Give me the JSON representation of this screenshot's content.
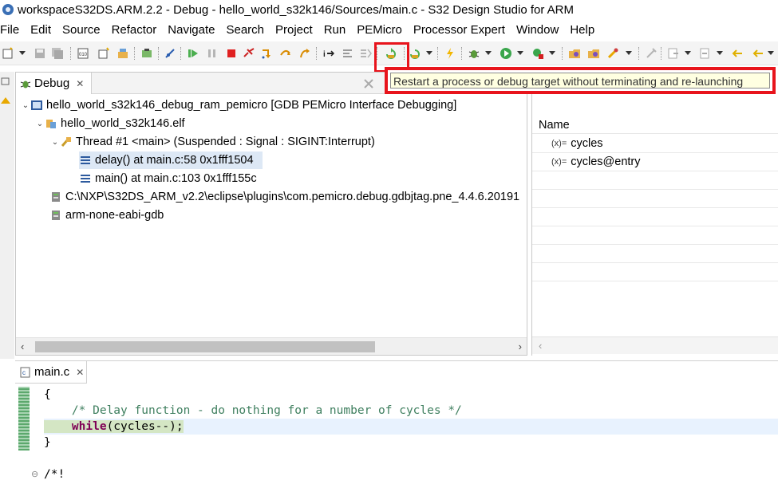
{
  "window": {
    "title": "workspaceS32DS.ARM.2.2 - Debug - hello_world_s32k146/Sources/main.c - S32 Design Studio for ARM"
  },
  "menu": [
    "File",
    "Edit",
    "Source",
    "Refactor",
    "Navigate",
    "Search",
    "Project",
    "Run",
    "PEMicro",
    "Processor Expert",
    "Window",
    "Help"
  ],
  "toolbar": {
    "tooltip": "Restart a process or debug target without terminating and re-launching"
  },
  "debug_view": {
    "tab_label": "Debug",
    "tree": [
      {
        "label": "hello_world_s32k146_debug_ram_pemicro [GDB PEMicro Interface Debugging]",
        "icon": "launch-config-icon"
      },
      {
        "label": "hello_world_s32k146.elf",
        "icon": "process-icon"
      },
      {
        "label": "Thread #1 <main> (Suspended : Signal : SIGINT:Interrupt)",
        "icon": "thread-icon"
      },
      {
        "label": "delay() at main.c:58 0x1fff1504",
        "icon": "stack-frame-icon"
      },
      {
        "label": "main() at main.c:103 0x1fff155c",
        "icon": "stack-frame-icon"
      },
      {
        "label": "C:\\NXP\\S32DS_ARM_v2.2\\eclipse\\plugins\\com.pemicro.debug.gdbjtag.pne_4.4.6.20191",
        "icon": "gdb-server-icon"
      },
      {
        "label": "arm-none-eabi-gdb",
        "icon": "gdb-icon"
      }
    ]
  },
  "variables_view": {
    "column_name": "Name",
    "rows": [
      {
        "icon": "(x)=",
        "name": "cycles"
      },
      {
        "icon": "(x)=",
        "name": "cycles@entry"
      }
    ]
  },
  "editor": {
    "tab_label": "main.c",
    "lines": {
      "l1": "{",
      "l2_comment": "/* Delay function - do nothing for a number of cycles */",
      "l3_kw": "while",
      "l3_rest": "(cycles--);",
      "l4": "}",
      "l5": "/*!"
    }
  },
  "colors": {
    "highlight_red": "#e8141c",
    "selection": "#dde8f5",
    "comment": "#3f7f5f",
    "keyword": "#7f0055"
  }
}
